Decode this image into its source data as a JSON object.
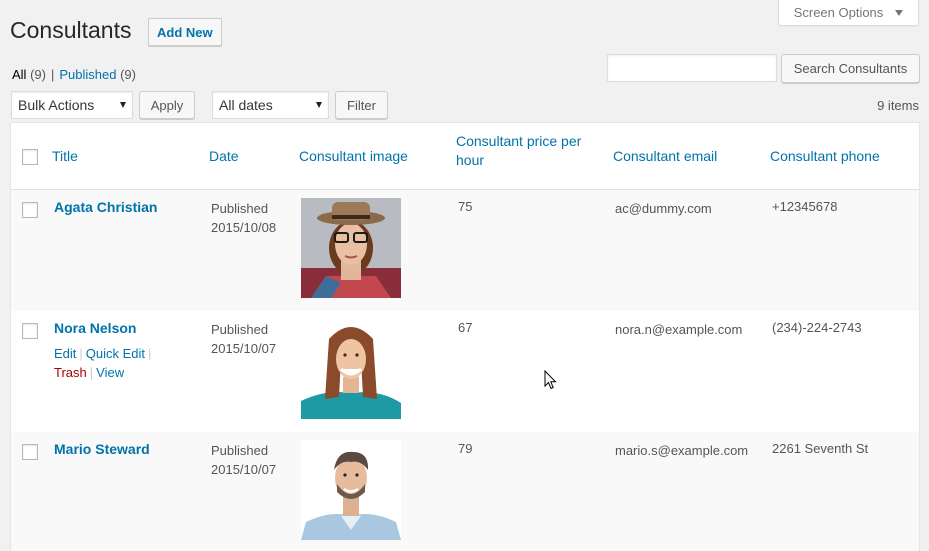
{
  "screen_options": {
    "label": "Screen Options"
  },
  "header": {
    "title": "Consultants",
    "add_new_label": "Add New"
  },
  "views": {
    "all_label": "All",
    "all_count": "(9)",
    "separator": "|",
    "published_label": "Published",
    "published_count": "(9)"
  },
  "search": {
    "placeholder": "",
    "button_label": "Search Consultants"
  },
  "bulk_actions": {
    "selected": "Bulk Actions",
    "apply_label": "Apply"
  },
  "date_filter": {
    "selected": "All dates",
    "filter_label": "Filter"
  },
  "items_count": "9 items",
  "table": {
    "columns": {
      "title": "Title",
      "date": "Date",
      "image": "Consultant image",
      "price": "Consultant price per hour",
      "email": "Consultant email",
      "phone": "Consultant phone"
    },
    "rows": [
      {
        "title": "Agata Christian",
        "status": "Published",
        "date": "2015/10/08",
        "price": "75",
        "email": "ac@dummy.com",
        "phone": "+12345678"
      },
      {
        "title": "Nora Nelson",
        "status": "Published",
        "date": "2015/10/07",
        "price": "67",
        "email": "nora.n@example.com",
        "phone": "(234)-224-2743",
        "actions": {
          "edit": "Edit",
          "quick_edit": "Quick Edit",
          "trash": "Trash",
          "view": "View",
          "sep": "|"
        }
      },
      {
        "title": "Mario Steward",
        "status": "Published",
        "date": "2015/10/07",
        "price": "79",
        "email": "mario.s@example.com",
        "phone": "2261 Seventh St"
      }
    ]
  },
  "colors": {
    "link": "#0073aa",
    "trash": "#a00",
    "background": "#f1f1f1",
    "row_alt": "#f9f9f9"
  },
  "icons": [
    "chevron-down-icon",
    "mouse-cursor-icon"
  ]
}
